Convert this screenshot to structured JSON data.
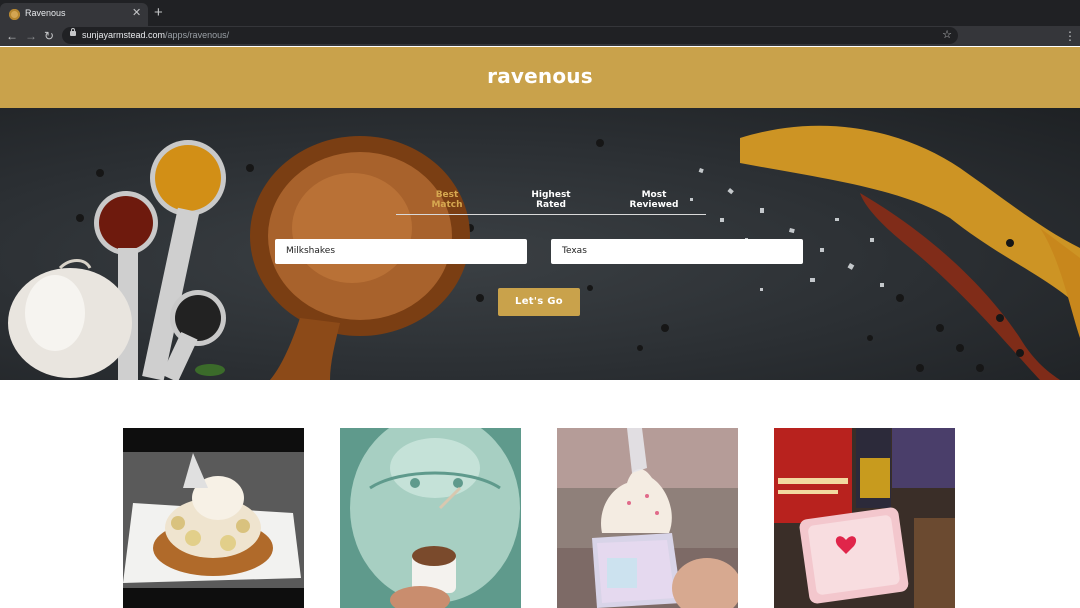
{
  "browser": {
    "tab_title": "Ravenous",
    "tab_close": "✕",
    "new_tab": "+",
    "back": "←",
    "forward": "→",
    "reload": "↻",
    "url_host": "sunjayarmstead.com",
    "url_path": "/apps/ravenous/",
    "bookmark_star": "☆",
    "menu": "⋮"
  },
  "header": {
    "logo": "ravenous"
  },
  "search": {
    "sort_options": [
      {
        "line1": "Best",
        "line2": "Match",
        "active": true
      },
      {
        "line1": "Highest",
        "line2": "Rated",
        "active": false
      },
      {
        "line1": "Most",
        "line2": "Reviewed",
        "active": false
      }
    ],
    "term_value": "Milkshakes",
    "location_value": "Texas",
    "submit_label": "Let's Go"
  },
  "results": [
    {
      "image": "waffle-milkshake-photo"
    },
    {
      "image": "ice-cream-cup-photo"
    },
    {
      "image": "soft-serve-cone-photo"
    },
    {
      "image": "we-love-customers-sign-photo"
    }
  ],
  "colors": {
    "brand": "#c9a24b",
    "active_tab": "#d6a850",
    "chrome": "#202124"
  }
}
